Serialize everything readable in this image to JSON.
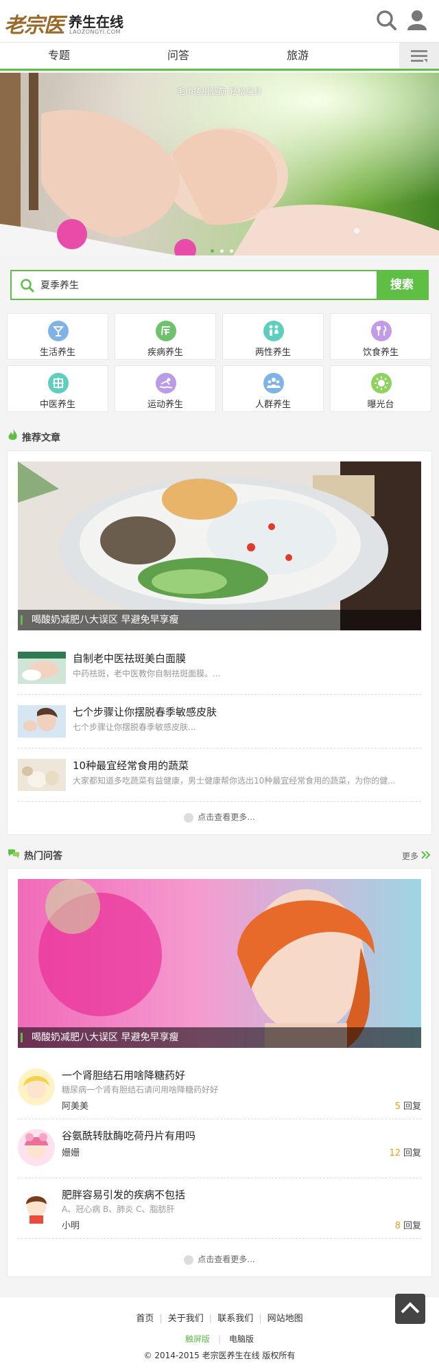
{
  "header": {
    "logo_mark": "老宗医",
    "site_name": "养生在线",
    "site_domain": "LAOZONGYI.COM"
  },
  "nav": {
    "items": [
      "专题",
      "问答",
      "旅游"
    ]
  },
  "banner": {
    "caption": "毛巾搓用腿筋 轻松瘦身"
  },
  "search": {
    "value": "夏季养生",
    "button": "搜索"
  },
  "categories": [
    {
      "label": "生活养生",
      "icon": "cocktail-icon",
      "color": "#7fb3e8"
    },
    {
      "label": "疾病养生",
      "icon": "illness-icon",
      "color": "#6cc36c"
    },
    {
      "label": "两性养生",
      "icon": "couple-icon",
      "color": "#5ccfbf"
    },
    {
      "label": "饮食养生",
      "icon": "utensils-icon",
      "color": "#c39be6"
    },
    {
      "label": "中医养生",
      "icon": "tcm-icon",
      "color": "#5ccfbf"
    },
    {
      "label": "运动养生",
      "icon": "swim-icon",
      "color": "#b99be6"
    },
    {
      "label": "人群养生",
      "icon": "people-icon",
      "color": "#7fb3e8"
    },
    {
      "label": "曝光台",
      "icon": "sun-icon",
      "color": "#8fd35f"
    }
  ],
  "recommend": {
    "title": "推荐文章",
    "cover_caption": "喝酸奶减肥八大误区 早避免早享瘦",
    "articles": [
      {
        "title": "自制老中医祛斑美白面膜",
        "desc": "中药祛斑，老中医教你自制祛斑面膜。..."
      },
      {
        "title": "七个步骤让你摆脱春季敏感皮肤",
        "desc": "七个步骤让你摆脱春季敏感皮肤..."
      },
      {
        "title": "10种最宜经常食用的蔬菜",
        "desc": "大家都知道多吃蔬菜有益健康，男士健康帮你选出10种最宜经常食用的蔬菜，为你的健..."
      }
    ],
    "more": "点击查看更多..."
  },
  "hotqa": {
    "title": "热门问答",
    "more_link": "更多",
    "cover_caption": "喝酸奶减肥八大误区 早避免早享瘦",
    "questions": [
      {
        "title": "一个肾胆结石用啥降糖药好",
        "desc": "糖尿病一个肾有胆结石请问用啥降糖药好好",
        "user": "阿美美",
        "count": "5",
        "reply_label": "回复"
      },
      {
        "title": "谷氨酰转肽酶吃荷丹片有用吗",
        "desc": "",
        "user": "姗姗",
        "count": "12",
        "reply_label": "回复"
      },
      {
        "title": "肥胖容易引发的疾病不包括",
        "desc": "A、冠心病 B、肺炎 C、脂肪肝",
        "user": "小明",
        "count": "8",
        "reply_label": "回复"
      }
    ],
    "more": "点击查看更多..."
  },
  "footer": {
    "links": [
      "首页",
      "关于我们",
      "联系我们",
      "网站地图"
    ],
    "version_touch": "触屏版",
    "version_pc": "电脑版",
    "copyright": "© 2014-2015 老宗医养生在线 版权所有"
  },
  "colors": {
    "accent": "#5fbf45",
    "reply_count": "#f39c12"
  }
}
